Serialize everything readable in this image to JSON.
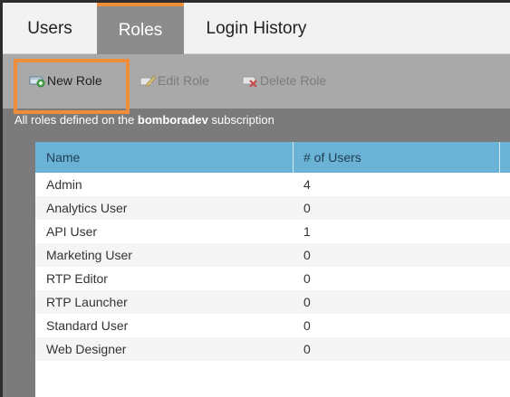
{
  "tabs": [
    {
      "label": "Users"
    },
    {
      "label": "Roles"
    },
    {
      "label": "Login History"
    }
  ],
  "toolbar": {
    "new_role": "New Role",
    "edit_role": "Edit Role",
    "delete_role": "Delete Role"
  },
  "caption": {
    "prefix": "All roles defined on the ",
    "subscription": "bomboradev",
    "suffix": " subscription"
  },
  "table": {
    "columns": [
      "Name",
      "# of Users"
    ],
    "rows": [
      {
        "name": "Admin",
        "users": "4"
      },
      {
        "name": "Analytics User",
        "users": "0"
      },
      {
        "name": "API User",
        "users": "1"
      },
      {
        "name": "Marketing User",
        "users": "0"
      },
      {
        "name": "RTP Editor",
        "users": "0"
      },
      {
        "name": "RTP Launcher",
        "users": "0"
      },
      {
        "name": "Standard User",
        "users": "0"
      },
      {
        "name": "Web Designer",
        "users": "0"
      }
    ]
  },
  "colors": {
    "active_tab_accent": "#ef8d3a",
    "header_blue": "#6bb3d6",
    "toolbar_gray": "#a9a9a9"
  }
}
